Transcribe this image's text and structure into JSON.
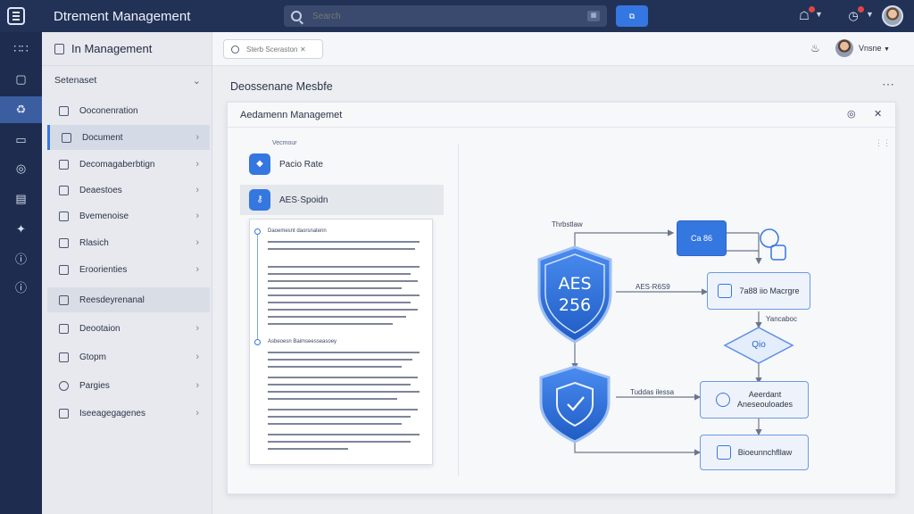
{
  "app": {
    "title": "Dtrement Management"
  },
  "topbar": {
    "search_placeholder": "Search",
    "search_button": "⧉",
    "icons": [
      "notification-icon",
      "timer-icon",
      "user-avatar"
    ]
  },
  "rail": {
    "items": [
      "apps-grid-icon",
      "inbox-icon",
      "security-icon",
      "card-icon",
      "globe-icon",
      "briefcase-icon",
      "tools-icon",
      "info-icon",
      "help-icon"
    ],
    "active_index": 2
  },
  "sidebar": {
    "header": "In Management",
    "section": "Setenaset",
    "items": [
      {
        "label": "Ooconenration"
      },
      {
        "label": "Document"
      },
      {
        "label": "Decomagaberbtign"
      },
      {
        "label": "Deaestoes"
      },
      {
        "label": "Bvemenoise"
      },
      {
        "label": "Rlasich"
      },
      {
        "label": "Eroorienties"
      },
      {
        "label": "Reesdeyrenanal"
      },
      {
        "label": "Deootaion"
      },
      {
        "label": "Gtopm"
      },
      {
        "label": "Pargies"
      },
      {
        "label": "Iseeagegagenes"
      }
    ]
  },
  "main_header": {
    "search_placeholder": "Sterb Sceraston",
    "user_name": "Vnsne"
  },
  "content": {
    "page_title": "Deossenane Mesbfe",
    "panel_title": "Aedamenn Managemet",
    "files": {
      "label": "Vecmour",
      "items": [
        "Pacio Rate",
        "AES·Spoidn"
      ]
    },
    "document": {
      "title": "Daoemesnt daorsnatenn",
      "subtitle": "Asbeoesn Baimseesseasoey"
    },
    "diagram": {
      "top_label": "Thrbstlaw",
      "shield_text": [
        "AES",
        "256"
      ],
      "aes_label": "AES·R6S9",
      "node_top": "Ca 86",
      "node_mid": "7a88 iio Macrgre",
      "mid_label": "Yancaboc",
      "diamond_text": "Qio",
      "node_lower": [
        "Aeerdant",
        "Aneseouloades"
      ],
      "lower_label": "Tuddas ilessa",
      "node_bottom": "Bioeunnchfllaw"
    }
  },
  "colors": {
    "topbar": "#223256",
    "rail": "#1d2c4f",
    "accent": "#3577e0",
    "shield": "#2f6fd6"
  }
}
